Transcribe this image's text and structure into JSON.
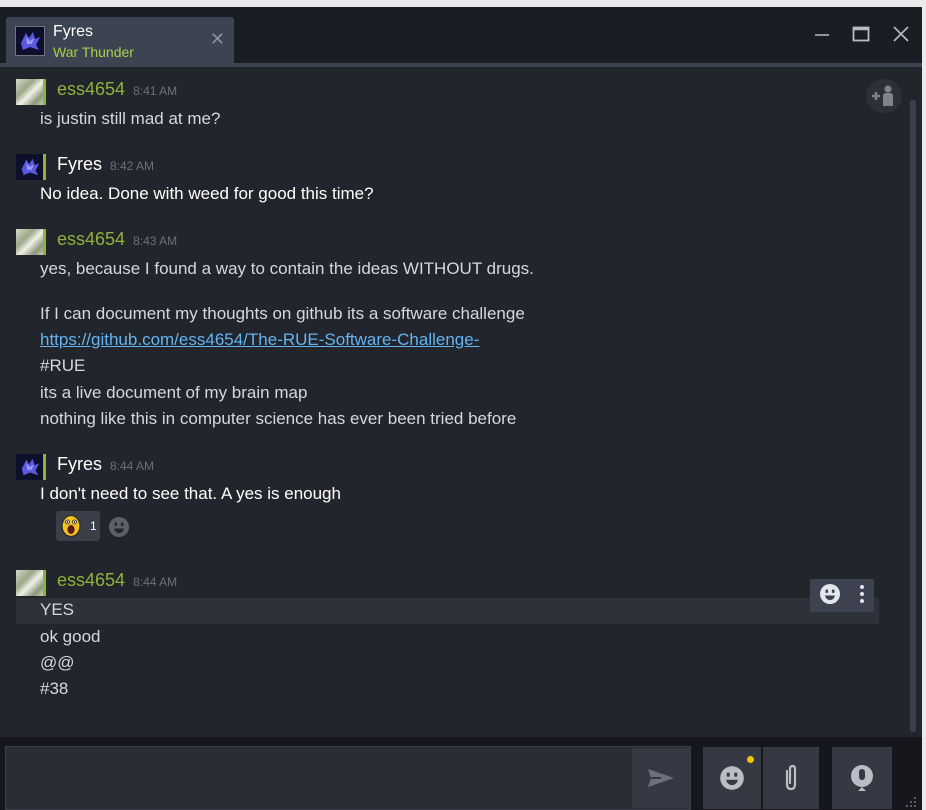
{
  "window": {
    "tab": {
      "name": "Fyres",
      "game": "War Thunder"
    }
  },
  "messages": [
    {
      "sender": "ess4654",
      "time": "8:41 AM",
      "lines": [
        "is justin still mad at me?"
      ]
    },
    {
      "sender": "Fyres",
      "time": "8:42 AM",
      "lines": [
        "No idea. Done with weed for good this time?"
      ]
    },
    {
      "sender": "ess4654",
      "time": "8:43 AM",
      "lines": [
        "yes, because I found a way to contain the ideas WITHOUT drugs.",
        "If I can document my thoughts on github its a software challenge",
        "https://github.com/ess4654/The-RUE-Software-Challenge-",
        "#RUE",
        "its a live document of my brain map",
        "nothing like this in computer science has ever been tried before"
      ]
    },
    {
      "sender": "Fyres",
      "time": "8:44 AM",
      "lines": [
        "I don't need to see that. A yes is enough"
      ],
      "reaction": {
        "count": "1"
      }
    },
    {
      "sender": "ess4654",
      "time": "8:44 AM",
      "lines": [
        "YES",
        "ok good",
        "@@",
        "#38"
      ]
    }
  ],
  "colors": {
    "accent_green": "#8fb339",
    "link_blue": "#63b4f0",
    "game_green": "#a6d24b",
    "notification_yellow": "#f5c400"
  },
  "icons": {
    "minimize": "minimize-icon",
    "maximize": "maximize-icon",
    "close": "close-icon",
    "add_friend": "add-friend-icon",
    "send": "send-icon",
    "emoji": "emoji-icon",
    "attach": "paperclip-icon",
    "voice": "microphone-icon"
  }
}
